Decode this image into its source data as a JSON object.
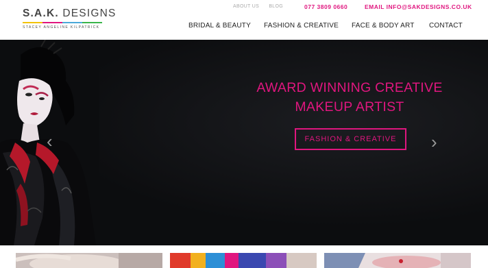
{
  "brand": {
    "title_bold": "S.A.K.",
    "title_rest": " DESIGNS",
    "subtitle": "STACEY ANGELINE KILPATRICK",
    "bar_colors": [
      "#f2c200",
      "#e0167f",
      "#4aa8d8",
      "#39b54a"
    ]
  },
  "toplinks": {
    "about": "ABOUT US",
    "blog": "BLOG"
  },
  "contact": {
    "phone": "077 3809 0660",
    "email": "EMAIL INFO@SAKDESIGNS.CO.UK"
  },
  "nav": {
    "items": [
      "BRIDAL & BEAUTY",
      "FASHION & CREATIVE",
      "FACE & BODY ART",
      "CONTACT"
    ]
  },
  "hero": {
    "headline_line1": "AWARD WINNING CREATIVE",
    "headline_line2": "MAKEUP ARTIST",
    "button_label": "FASHION & CREATIVE",
    "prev_icon": "‹",
    "next_icon": "›"
  },
  "colors": {
    "accent": "#e0167f",
    "hero_bg": "#0c0d0f"
  }
}
